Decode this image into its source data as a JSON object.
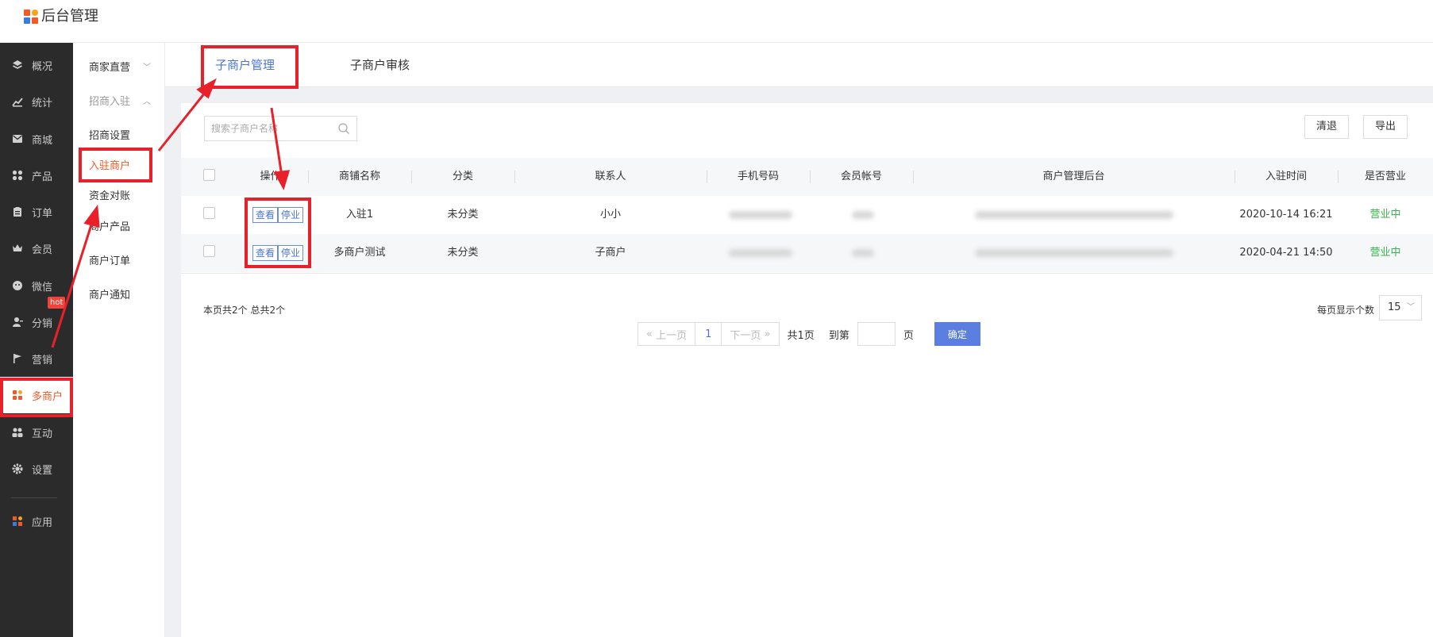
{
  "app": {
    "title": "后台管理",
    "logo_colors": [
      "#f05a28",
      "#f7a41d",
      "#3b7be0",
      "#f05a28"
    ]
  },
  "sidebar": {
    "items": [
      {
        "label": "概况",
        "icon": "layers-icon"
      },
      {
        "label": "统计",
        "icon": "chart-icon"
      },
      {
        "label": "商城",
        "icon": "mail-icon"
      },
      {
        "label": "产品",
        "icon": "grid-icon"
      },
      {
        "label": "订单",
        "icon": "clipboard-icon"
      },
      {
        "label": "会员",
        "icon": "crown-icon"
      },
      {
        "label": "微信",
        "icon": "wechat-icon"
      },
      {
        "label": "分销",
        "icon": "user-share-icon"
      },
      {
        "label": "营销",
        "icon": "flag-icon"
      },
      {
        "label": "多商户",
        "icon": "multi-store-icon"
      },
      {
        "label": "互动",
        "icon": "group-icon"
      },
      {
        "label": "设置",
        "icon": "gear-icon"
      },
      {
        "label": "应用",
        "icon": "apps-icon"
      }
    ],
    "hot_badge": "hot",
    "active_color": "#f05a28"
  },
  "submenu": {
    "items": [
      {
        "label": "商家直营"
      },
      {
        "label": "招商入驻"
      },
      {
        "label": "招商设置"
      },
      {
        "label": "入驻商户"
      },
      {
        "label": "资金对账"
      },
      {
        "label": "商户产品"
      },
      {
        "label": "商户订单"
      },
      {
        "label": "商户通知"
      }
    ]
  },
  "tabs": [
    {
      "label": "子商户管理"
    },
    {
      "label": "子商户审核"
    }
  ],
  "toolbar": {
    "search_placeholder": "搜索子商户名称",
    "clear_label": "清退",
    "export_label": "导出"
  },
  "table": {
    "headers": [
      "操作",
      "商铺名称",
      "分类",
      "联系人",
      "手机号码",
      "会员帐号",
      "商户管理后台",
      "入驻时间",
      "是否营业"
    ],
    "view_label": "查看",
    "stop_label": "停业",
    "rows": [
      {
        "name": "入驻1",
        "category": "未分类",
        "contact": "小小",
        "time": "2020-10-14 16:21",
        "status": "营业中"
      },
      {
        "name": "多商户测试",
        "category": "未分类",
        "contact": "子商户",
        "time": "2020-04-21 14:50",
        "status": "营业中"
      }
    ],
    "status_color": "#36b34a"
  },
  "footer": {
    "count_text": "本页共2个  总共2个",
    "prev_label": "上一页",
    "page": "1",
    "next_label": "下一页",
    "total_pages": "共1页",
    "goto_label": "到第",
    "page_unit": "页",
    "confirm_label": "确定",
    "per_page_label": "每页显示个数",
    "per_page_value": "15"
  },
  "annotation_color": "#e8202a"
}
